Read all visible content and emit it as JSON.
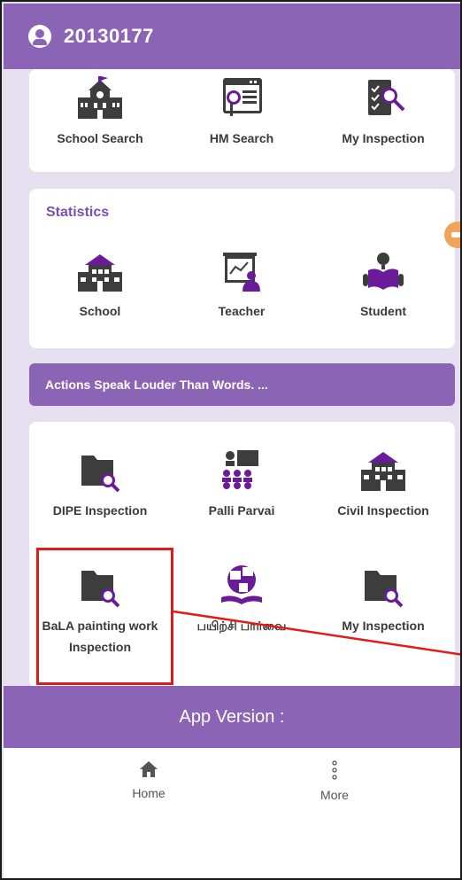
{
  "header": {
    "user_id": "20130177"
  },
  "top_card": {
    "tiles": [
      {
        "label": "School Search",
        "icon": "school-building-icon"
      },
      {
        "label": "HM Search",
        "icon": "web-search-icon"
      },
      {
        "label": "My Inspection",
        "icon": "checklist-search-icon"
      }
    ]
  },
  "statistics": {
    "title": "Statistics",
    "tiles": [
      {
        "label": "School",
        "icon": "school-icon"
      },
      {
        "label": "Teacher",
        "icon": "teacher-board-icon"
      },
      {
        "label": "Student",
        "icon": "student-reading-icon"
      }
    ]
  },
  "banner": {
    "text": "Actions Speak Louder Than Words. ..."
  },
  "inspections": {
    "tiles": [
      {
        "label": "DIPE Inspection",
        "icon": "folder-search-icon"
      },
      {
        "label": "Palli Parvai",
        "icon": "group-presentation-icon"
      },
      {
        "label": "Civil Inspection",
        "icon": "building-icon"
      },
      {
        "label": "BaLA painting work Inspection",
        "icon": "folder-search-icon"
      },
      {
        "label": "பயிற்சி பார்வை",
        "icon": "language-book-icon"
      },
      {
        "label": "My Inspection",
        "icon": "folder-search-icon"
      },
      {
        "label": "",
        "icon": "classroom-teacher-icon"
      },
      {
        "label": "",
        "icon": "secure-computer-icon"
      }
    ]
  },
  "footer": {
    "app_version": "App Version :"
  },
  "nav": {
    "home": {
      "label": "Home",
      "icon": "home-icon"
    },
    "more": {
      "label": "More",
      "icon": "more-vertical-icon"
    }
  },
  "colors": {
    "primary": "#8b64b5",
    "icon_dark": "#3d3d3d",
    "icon_purple": "#6a1b9a",
    "background": "#e6dff0",
    "annotation": "#e11a1a"
  }
}
